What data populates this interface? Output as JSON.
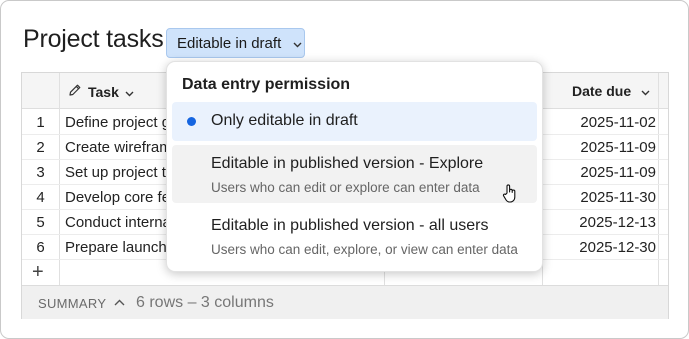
{
  "header": {
    "title": "Project tasks",
    "permission_button_label": "Editable in draft",
    "permission_button_icon": "chevron-down-icon"
  },
  "table": {
    "columns": [
      {
        "label": "Task",
        "icon": "pencil-icon"
      },
      {
        "label": "Date due"
      }
    ],
    "rows": [
      {
        "num": "1",
        "task": "Define project g",
        "date": "2025-11-02"
      },
      {
        "num": "2",
        "task": "Create wirefram",
        "date": "2025-11-09"
      },
      {
        "num": "3",
        "task": "Set up project t",
        "date": "2025-11-09"
      },
      {
        "num": "4",
        "task": "Develop core fe",
        "date": "2025-11-30"
      },
      {
        "num": "5",
        "task": "Conduct interna",
        "date": "2025-12-13"
      },
      {
        "num": "6",
        "task": "Prepare launch",
        "date": "2025-12-30"
      }
    ],
    "add_row_symbol": "+"
  },
  "summary": {
    "label": "SUMMARY",
    "toggle_symbol": "^",
    "count_text": "6 rows – 3 columns"
  },
  "dropdown": {
    "heading": "Data entry permission",
    "options": [
      {
        "label": "Only editable in draft",
        "selected": true
      },
      {
        "label": "Editable in published version - Explore",
        "description": "Users who can edit or explore can enter data",
        "hovered": true
      },
      {
        "label": "Editable in published version - all users",
        "description": "Users who can edit, explore, or view can enter data"
      }
    ]
  },
  "colors": {
    "button_bg": "#cfe3fb",
    "selected_bg": "#eaf2fd",
    "selected_dot": "#1565e0",
    "hover_bg": "#f2f2f2"
  }
}
